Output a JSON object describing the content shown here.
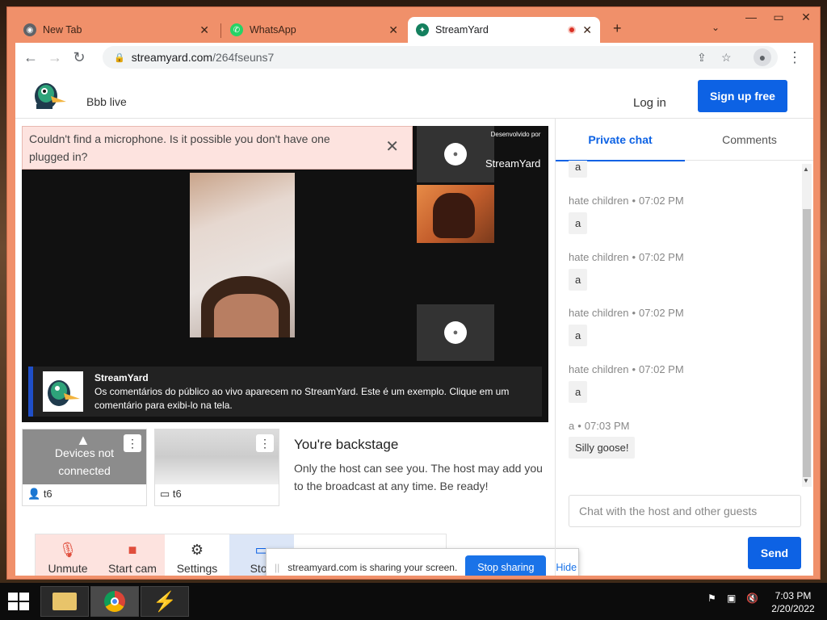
{
  "browser": {
    "tabs": [
      {
        "title": "New Tab"
      },
      {
        "title": "WhatsApp"
      },
      {
        "title": "StreamYard"
      }
    ],
    "url_domain": "streamyard.com",
    "url_path": "/264fseuns7"
  },
  "header": {
    "studio_name": "Bbb live",
    "login": "Log in",
    "signup": "Sign up free"
  },
  "error": {
    "message": "Couldn't find a microphone. Is it possible you don't have one plugged in?"
  },
  "stage": {
    "brand_small": "Desenvolvido por",
    "brand_name": "StreamYard",
    "banner_title": "StreamYard",
    "banner_text": "Os comentários do público ao vivo aparecem no StreamYard. Este é um exemplo. Clique em um comentário para exibi-lo na tela."
  },
  "participants": [
    {
      "status": "Devices not connected",
      "name": "t6"
    },
    {
      "name": "t6"
    }
  ],
  "backstage": {
    "title": "You're backstage",
    "text": "Only the host can see you. The host may add you to the broadcast at any time. Be ready!"
  },
  "controls": {
    "unmute": "Unmute",
    "start_cam": "Start cam",
    "settings": "Settings",
    "stop": "Stop"
  },
  "share_bar": {
    "message": "streamyard.com is sharing your screen.",
    "stop": "Stop sharing",
    "hide": "Hide"
  },
  "chat": {
    "tabs": {
      "private": "Private chat",
      "comments": "Comments"
    },
    "messages": [
      {
        "author": "",
        "time": "",
        "text": "a"
      },
      {
        "author": "hate children",
        "time": "07:02 PM",
        "text": "a"
      },
      {
        "author": "hate children",
        "time": "07:02 PM",
        "text": "a"
      },
      {
        "author": "hate children",
        "time": "07:02 PM",
        "text": "a"
      },
      {
        "author": "hate children",
        "time": "07:02 PM",
        "text": "a"
      },
      {
        "author": "a",
        "time": "07:03 PM",
        "text": "Silly goose!"
      }
    ],
    "placeholder": "Chat with the host and other guests",
    "send": "Send"
  },
  "taskbar": {
    "time": "7:03 PM",
    "date": "2/20/2022"
  },
  "colors": {
    "accent": "#0d62e4",
    "window_frame": "#f0906a",
    "error_bg": "#fde3df"
  }
}
